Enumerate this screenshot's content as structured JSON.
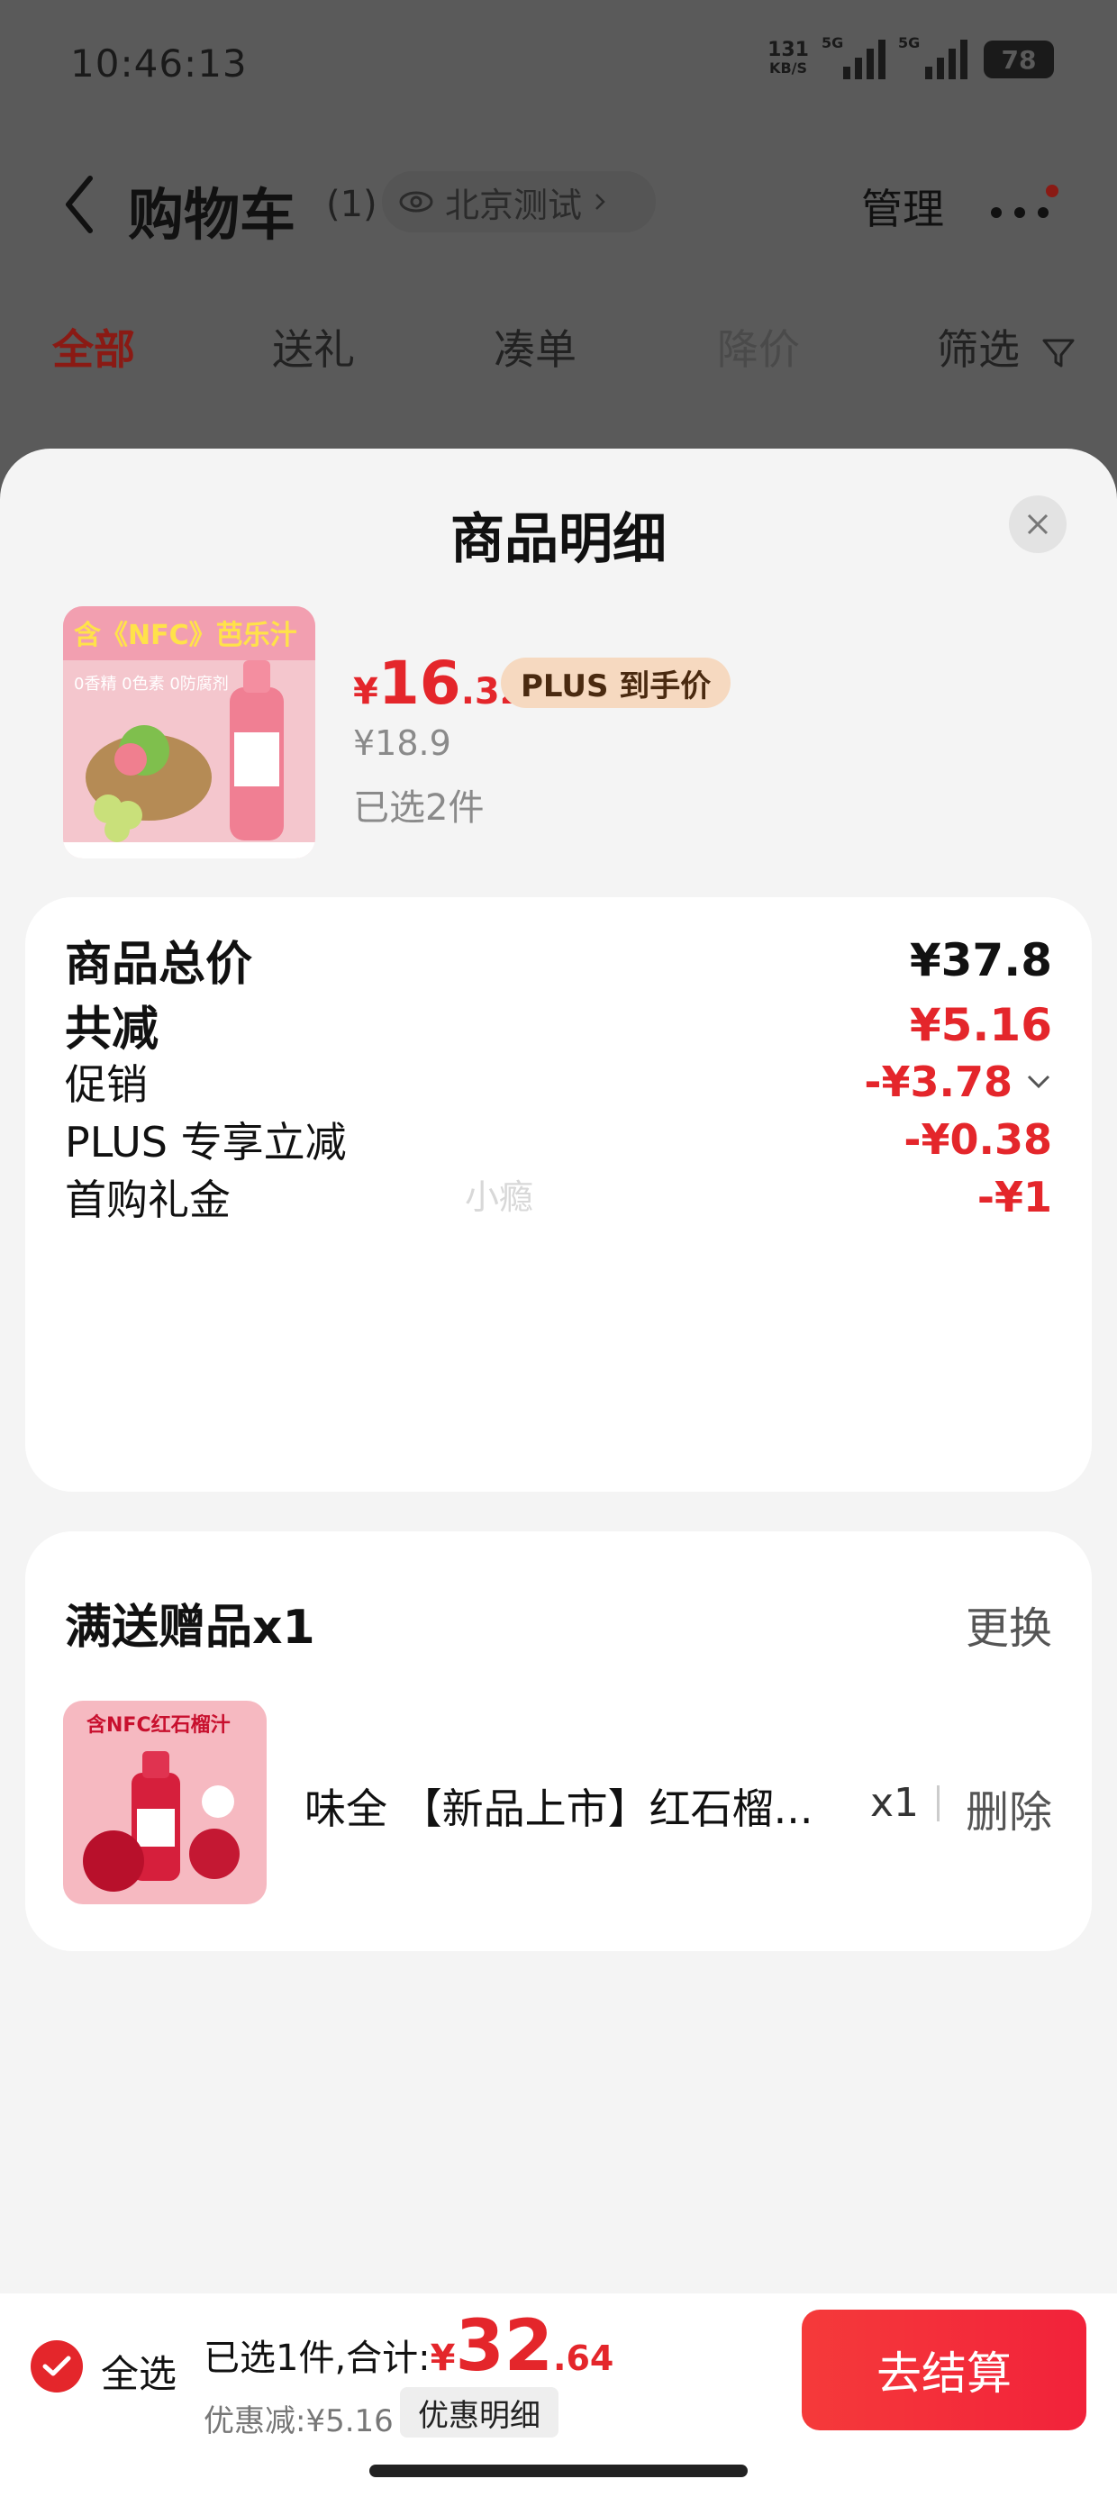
{
  "status": {
    "time": "10:46:13",
    "speed_value": "131",
    "speed_unit": "KB/S",
    "sim1_tag": "5G",
    "sim2_tag": "5G",
    "battery": "78"
  },
  "header": {
    "title": "购物车",
    "count": "(1)",
    "location": "北京测试",
    "manage": "管理"
  },
  "tabs": [
    {
      "label": "全部"
    },
    {
      "label": "送礼"
    },
    {
      "label": "凑单"
    },
    {
      "label": "降价"
    },
    {
      "label": "筛选"
    }
  ],
  "sheet": {
    "title": "商品明细",
    "product": {
      "price_yen": "¥",
      "price_int": "16",
      "price_dec": ".32",
      "plus_badge": "PLUS 到手价",
      "original_price": "¥18.9",
      "selected": "已选2件"
    },
    "breakdown": {
      "total_label": "商品总价",
      "total_value": "¥37.8",
      "reduce_label": "共减",
      "reduce_value": "¥5.16",
      "promo_label": "促销",
      "promo_value": "-¥3.78",
      "plus_label": "PLUS 专享立减",
      "plus_value": "-¥0.38",
      "first_label": "首购礼金",
      "first_value": "-¥1",
      "watermark": "小瘾"
    },
    "gift": {
      "title": "满送赠品x1",
      "swap": "更换",
      "name": "味全 【新品上市】红石榴...",
      "qty": "x1",
      "delete": "删除"
    }
  },
  "bottom": {
    "select_all": "全选",
    "summary_text": "已选1件,合计:",
    "total_yen": "¥",
    "total_int": "32",
    "total_dec": ".64",
    "discount": "优惠减:¥5.16",
    "detail_button": "优惠明细",
    "checkout": "去结算"
  },
  "colors": {
    "accent_red": "#e4262b",
    "plus_badge_bg": "#f6d9c0"
  }
}
